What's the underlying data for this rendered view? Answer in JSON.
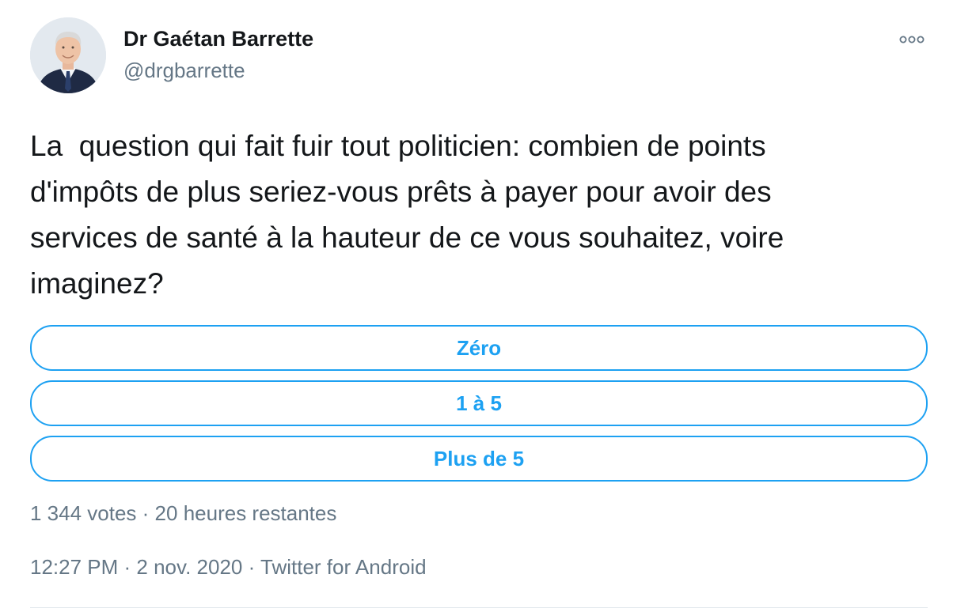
{
  "author": {
    "display_name": "Dr Gaétan Barrette",
    "handle": "@drgbarrette",
    "avatar": "profile-photo"
  },
  "menu": {
    "icon": "more-options-icon"
  },
  "tweet": {
    "text": "La  question qui fait fuir tout politicien: combien de points\nd'impôts de plus seriez-vous prêts à payer pour avoir des\nservices de santé à la hauteur de ce vous souhaitez, voire\nimaginez?"
  },
  "poll": {
    "options": [
      {
        "label": "Zéro"
      },
      {
        "label": "1 à 5"
      },
      {
        "label": "Plus de 5"
      }
    ],
    "votes": "1 344 votes",
    "separator": " · ",
    "time_left": "20 heures restantes"
  },
  "meta": {
    "time": "12:27 PM",
    "date": "2 nov. 2020",
    "source": "Twitter for Android",
    "separator": " · "
  },
  "colors": {
    "accent": "#1da1f2",
    "text": "#14171a",
    "secondary": "#657786",
    "divider": "#e1e8ed"
  }
}
